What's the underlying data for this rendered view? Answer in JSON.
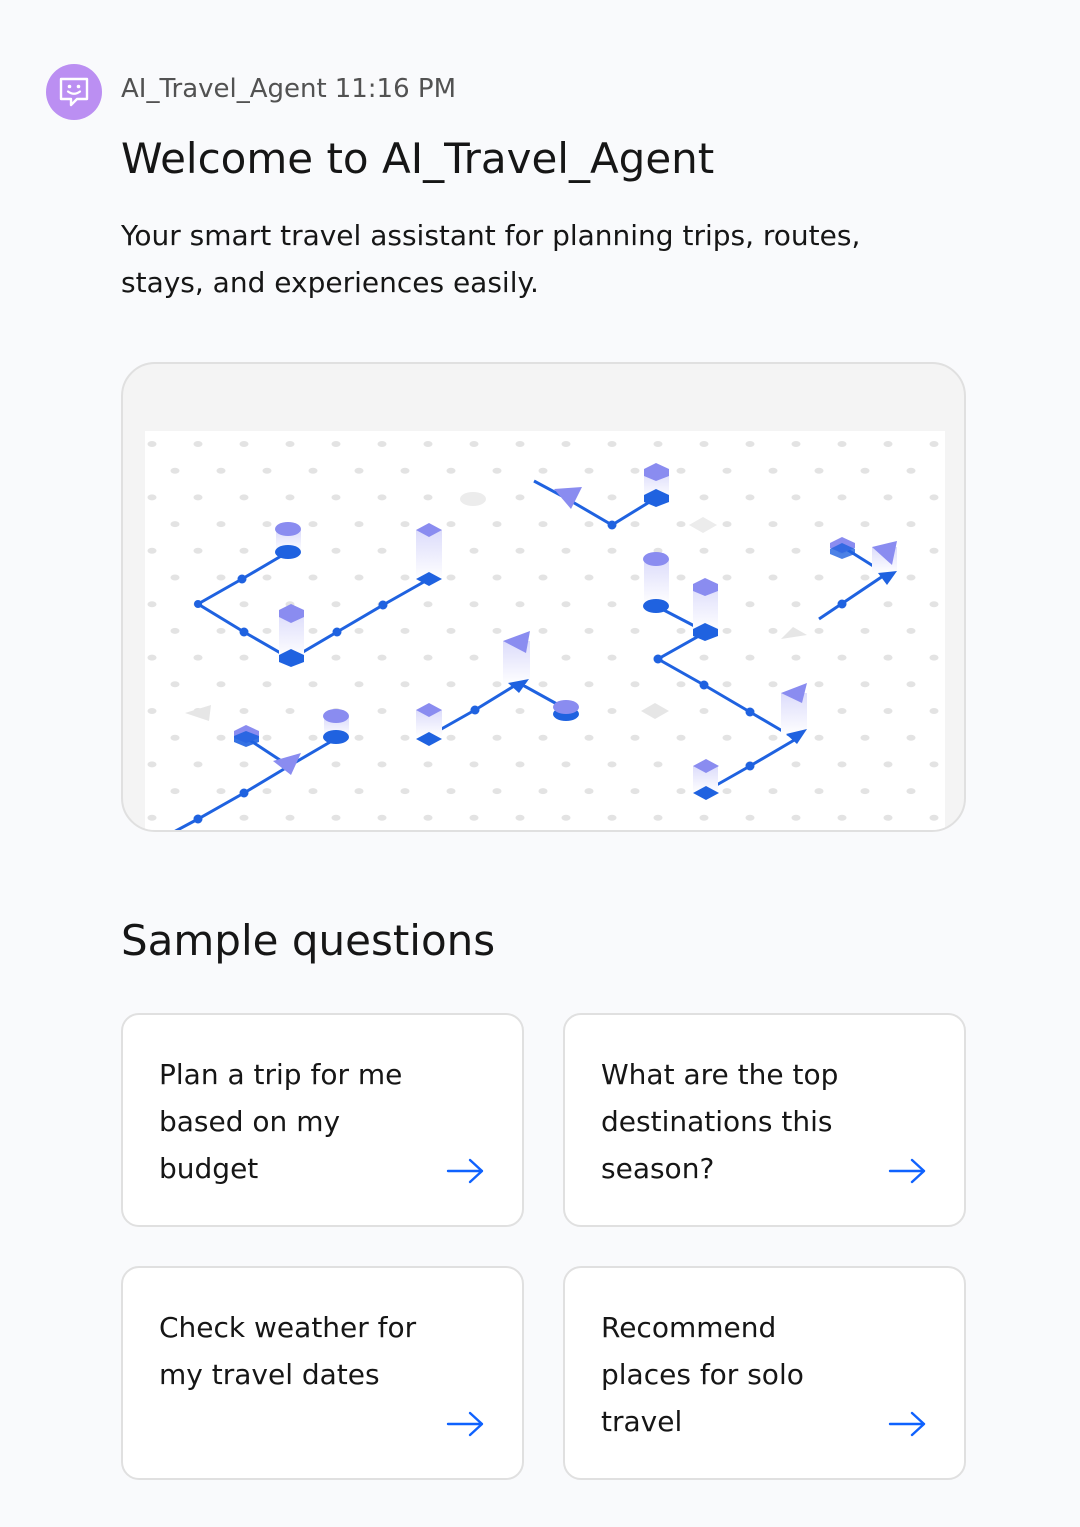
{
  "message": {
    "sender": "AI_Travel_Agent",
    "time": "11:16 PM",
    "avatar_icon": "chat-bot-icon",
    "title": "Welcome to AI_Travel_Agent",
    "description": "Your smart travel assistant for planning trips, routes, stays, and experiences easily."
  },
  "hero": {
    "illustration": "isometric-route-map-illustration"
  },
  "sample_questions": {
    "title": "Sample questions",
    "items": [
      {
        "text": "Plan a trip for me based on my budget",
        "icon": "arrow-right-icon"
      },
      {
        "text": "What are the top destinations this season?",
        "icon": "arrow-right-icon"
      },
      {
        "text": "Check weather for my travel dates",
        "icon": "arrow-right-icon"
      },
      {
        "text": "Recommend places for solo travel",
        "icon": "arrow-right-icon"
      }
    ]
  },
  "colors": {
    "avatar_bg": "#bb8ff2",
    "route_blue": "#1f62e0",
    "accent_purple": "#8a8cf0",
    "link_blue": "#0f62fe"
  }
}
